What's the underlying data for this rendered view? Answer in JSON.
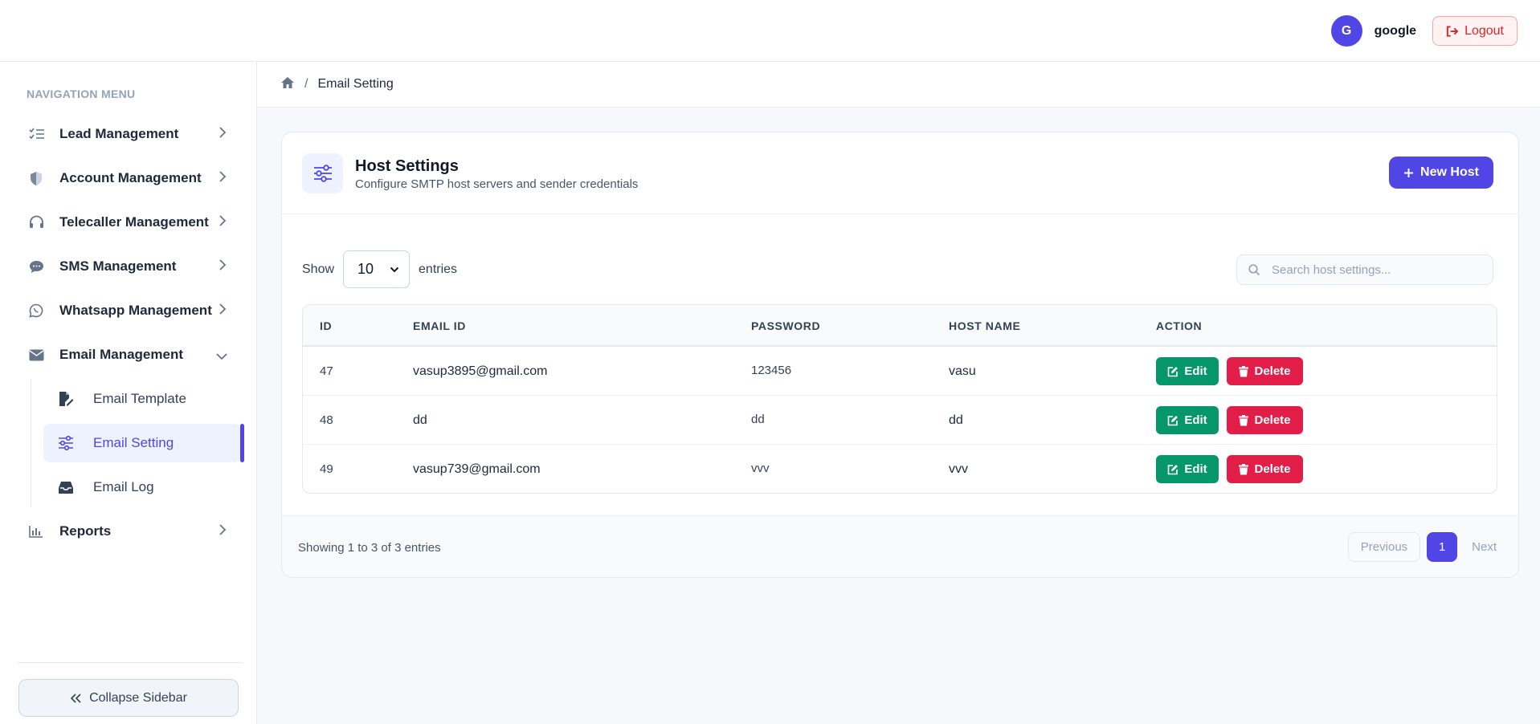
{
  "header": {
    "avatar_initial": "G",
    "username": "google",
    "logout_label": "Logout"
  },
  "sidebar": {
    "heading": "NAVIGATION MENU",
    "items": [
      {
        "label": "Lead Management",
        "icon": "list-check-icon"
      },
      {
        "label": "Account Management",
        "icon": "shield-icon"
      },
      {
        "label": "Telecaller Management",
        "icon": "headset-icon"
      },
      {
        "label": "SMS Management",
        "icon": "chat-icon"
      },
      {
        "label": "Whatsapp Management",
        "icon": "whatsapp-icon"
      },
      {
        "label": "Email Management",
        "icon": "envelope-icon"
      },
      {
        "label": "Reports",
        "icon": "chart-icon"
      }
    ],
    "email_subitems": [
      {
        "label": "Email Template",
        "icon": "file-edit-icon"
      },
      {
        "label": "Email Setting",
        "icon": "sliders-icon",
        "active": true
      },
      {
        "label": "Email Log",
        "icon": "inbox-icon"
      }
    ],
    "collapse_label": "Collapse Sidebar"
  },
  "breadcrumb": {
    "separator": "/",
    "current": "Email Setting"
  },
  "card": {
    "title": "Host Settings",
    "subtitle": "Configure SMTP host servers and sender credentials",
    "new_button": "New Host"
  },
  "controls": {
    "show_label": "Show",
    "entries_value": "10",
    "entries_label": "entries",
    "search_placeholder": "Search host settings..."
  },
  "table": {
    "headers": [
      "ID",
      "EMAIL ID",
      "PASSWORD",
      "HOST NAME",
      "ACTION"
    ],
    "rows": [
      {
        "id": "47",
        "email": "vasup3895@gmail.com",
        "password": "123456",
        "host": "vasu"
      },
      {
        "id": "48",
        "email": "dd",
        "password": "dd",
        "host": "dd"
      },
      {
        "id": "49",
        "email": "vasup739@gmail.com",
        "password": "vvv",
        "host": "vvv"
      }
    ],
    "edit_label": "Edit",
    "delete_label": "Delete"
  },
  "footer": {
    "showing_text": "Showing 1 to 3 of 3 entries",
    "previous_label": "Previous",
    "page": "1",
    "next_label": "Next"
  },
  "colors": {
    "accent": "#4f46e5",
    "edit": "#059669",
    "delete": "#e11d48"
  }
}
